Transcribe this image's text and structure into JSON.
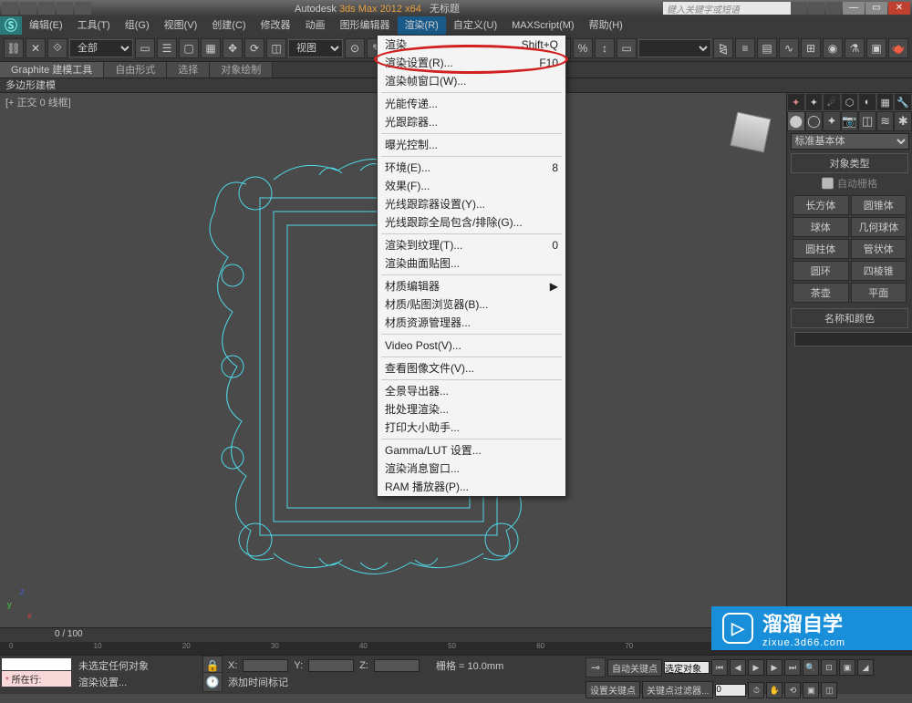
{
  "titlebar": {
    "app": "Autodesk",
    "product": "3ds Max  2012 x64",
    "doc": "无标题",
    "search_placeholder": "键入关键字或短语"
  },
  "menubar": [
    "编辑(E)",
    "工具(T)",
    "组(G)",
    "视图(V)",
    "创建(C)",
    "修改器",
    "动画",
    "图形编辑器",
    "渲染(R)",
    "自定义(U)",
    "MAXScript(M)",
    "帮助(H)"
  ],
  "menubar_active_index": 8,
  "toolbar_selection": "全部",
  "toolbar_viewmode": "视图",
  "ribbon_tabs": [
    "Graphite 建模工具",
    "自由形式",
    "选择",
    "对象绘制"
  ],
  "subbar_label": "多边形建模",
  "viewport_label": "[+ 正交 0 线框]",
  "dropdown": [
    {
      "label": "渲染",
      "accel": "Shift+Q"
    },
    {
      "label": "渲染设置(R)...",
      "accel": "F10"
    },
    {
      "label": "渲染帧窗口(W)...",
      "accel": ""
    },
    "__hr__",
    {
      "label": "光能传递...",
      "accel": ""
    },
    {
      "label": "光跟踪器...",
      "accel": ""
    },
    "__hr__",
    {
      "label": "曝光控制...",
      "accel": ""
    },
    "__hr__",
    {
      "label": "环境(E)...",
      "accel": "8"
    },
    {
      "label": "效果(F)...",
      "accel": ""
    },
    {
      "label": "光线跟踪器设置(Y)...",
      "accel": ""
    },
    {
      "label": "光线跟踪全局包含/排除(G)...",
      "accel": ""
    },
    "__hr__",
    {
      "label": "渲染到纹理(T)...",
      "accel": "0"
    },
    {
      "label": "渲染曲面贴图...",
      "accel": ""
    },
    "__hr__",
    {
      "label": "材质编辑器",
      "accel": "▶"
    },
    {
      "label": "材质/贴图浏览器(B)...",
      "accel": ""
    },
    {
      "label": "材质资源管理器...",
      "accel": ""
    },
    "__hr__",
    {
      "label": "Video Post(V)...",
      "accel": ""
    },
    "__hr__",
    {
      "label": "查看图像文件(V)...",
      "accel": ""
    },
    "__hr__",
    {
      "label": "全景导出器...",
      "accel": ""
    },
    {
      "label": "批处理渲染...",
      "accel": ""
    },
    {
      "label": "打印大小助手...",
      "accel": ""
    },
    "__hr__",
    {
      "label": "Gamma/LUT 设置...",
      "accel": ""
    },
    {
      "label": "渲染消息窗口...",
      "accel": ""
    },
    {
      "label": "RAM 播放器(P)...",
      "accel": ""
    }
  ],
  "panel": {
    "dropdown": "标准基本体",
    "section_objtype": "对象类型",
    "auto_grid": "自动栅格",
    "primitives": [
      "长方体",
      "圆锥体",
      "球体",
      "几何球体",
      "圆柱体",
      "管状体",
      "圆环",
      "四棱锥",
      "茶壶",
      "平面"
    ],
    "section_namecolor": "名称和颜色"
  },
  "timeline": {
    "range": "0 / 100"
  },
  "status": {
    "row_label": "所在行:",
    "no_selection": "未选定任何对象",
    "render_setup": "渲染设置...",
    "add_time_tag": "添加时间标记",
    "coord_x": "X:",
    "coord_y": "Y:",
    "coord_z": "Z:",
    "grid": "栅格 = 10.0mm",
    "auto_key": "自动关键点",
    "selected": "选定对象",
    "set_key": "设置关键点",
    "key_filters": "关键点过滤器..."
  },
  "watermark": {
    "brand": "溜溜自学",
    "url": "zixue.3d66.com"
  }
}
